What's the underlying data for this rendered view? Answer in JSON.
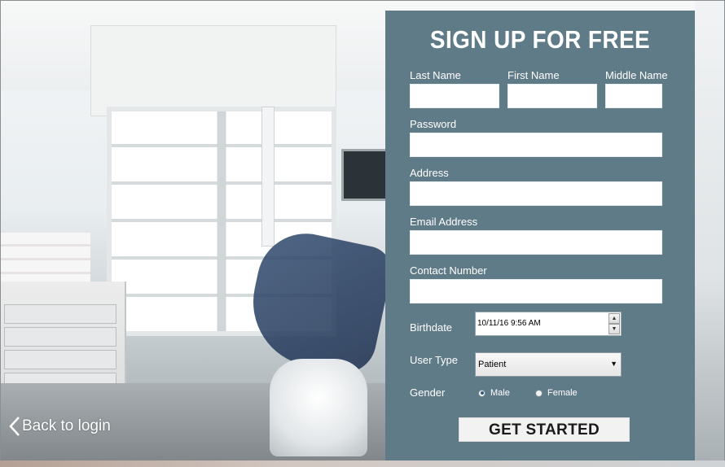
{
  "form": {
    "title": "SIGN UP FOR FREE",
    "last_name_label": "Last Name",
    "first_name_label": "First Name",
    "middle_name_label": "Middle Name",
    "password_label": "Password",
    "address_label": "Address",
    "email_label": "Email Address",
    "contact_label": "Contact Number",
    "birthdate_label": "Birthdate",
    "birthdate_value": "10/11/16  9:56 AM",
    "user_type_label": "User Type",
    "user_type_value": "Patient",
    "gender_label": "Gender",
    "gender_options": [
      "Male",
      "Female"
    ],
    "gender_selected": "Male",
    "submit_label": "GET STARTED"
  },
  "nav": {
    "back_label": "Back to login"
  },
  "colors": {
    "panel": "#607b88",
    "text": "#ffffff"
  }
}
